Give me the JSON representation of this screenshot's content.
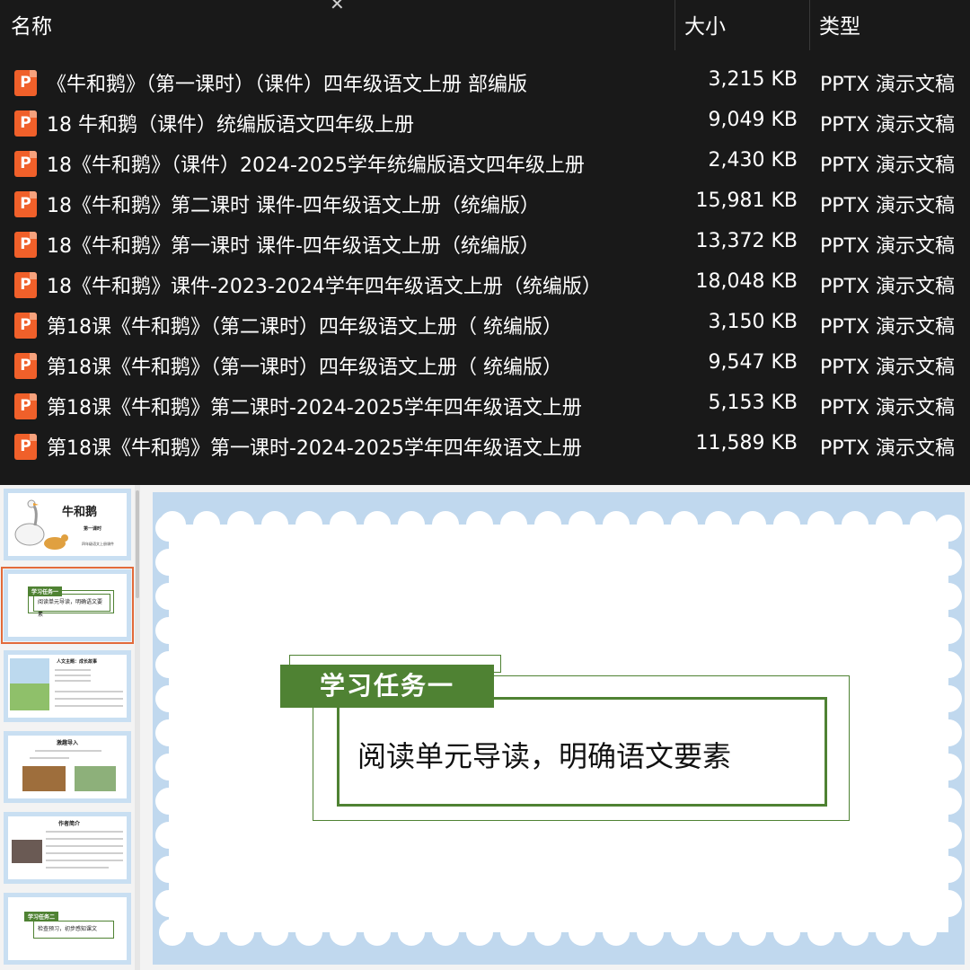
{
  "explorer": {
    "columns": {
      "name": "名称",
      "size": "大小",
      "type": "类型"
    },
    "files": [
      {
        "name": "《牛和鹅》（第一课时）（课件）四年级语文上册 部编版",
        "size": "3,215 KB",
        "type": "PPTX 演示文稿"
      },
      {
        "name": "18 牛和鹅（课件）统编版语文四年级上册",
        "size": "9,049 KB",
        "type": "PPTX 演示文稿"
      },
      {
        "name": "18《牛和鹅》（课件）2024-2025学年统编版语文四年级上册",
        "size": "2,430 KB",
        "type": "PPTX 演示文稿"
      },
      {
        "name": "18《牛和鹅》第二课时 课件-四年级语文上册（统编版）",
        "size": "15,981 KB",
        "type": "PPTX 演示文稿"
      },
      {
        "name": "18《牛和鹅》第一课时 课件-四年级语文上册（统编版）",
        "size": "13,372 KB",
        "type": "PPTX 演示文稿"
      },
      {
        "name": "18《牛和鹅》课件-2023-2024学年四年级语文上册（统编版）",
        "size": "18,048 KB",
        "type": "PPTX 演示文稿"
      },
      {
        "name": "第18课《牛和鹅》（第二课时）四年级语文上册（ 统编版）",
        "size": "3,150 KB",
        "type": "PPTX 演示文稿"
      },
      {
        "name": "第18课《牛和鹅》（第一课时）四年级语文上册（ 统编版）",
        "size": "9,547 KB",
        "type": "PPTX 演示文稿"
      },
      {
        "name": "第18课《牛和鹅》第二课时-2024-2025学年四年级语文上册",
        "size": "5,153 KB",
        "type": "PPTX 演示文稿"
      },
      {
        "name": "第18课《牛和鹅》第一课时-2024-2025学年四年级语文上册",
        "size": "11,589 KB",
        "type": "PPTX 演示文稿"
      }
    ]
  },
  "thumbnails": {
    "t1": {
      "title": "牛和鹅",
      "sub": "第一课时",
      "note": "四年级语文上册课件"
    },
    "t2": {
      "banner": "学习任务一",
      "text": "阅读单元导读，明确语文要素"
    },
    "t3": {
      "title": "人文主题：成长故事"
    },
    "t4": {
      "title": "激趣导入"
    },
    "t5": {
      "title": "作者简介"
    },
    "t6": {
      "banner": "学习任务二",
      "text": "检查预习，初步感知课文"
    }
  },
  "slide": {
    "banner": "学习任务一",
    "text": "阅读单元导读，明确语文要素"
  },
  "colors": {
    "green": "#4f8233",
    "frame_blue": "#c0d8ee",
    "pptx_orange": "#f0602a"
  },
  "icons": {
    "file": "pptx-file-icon",
    "close": "close-icon"
  }
}
